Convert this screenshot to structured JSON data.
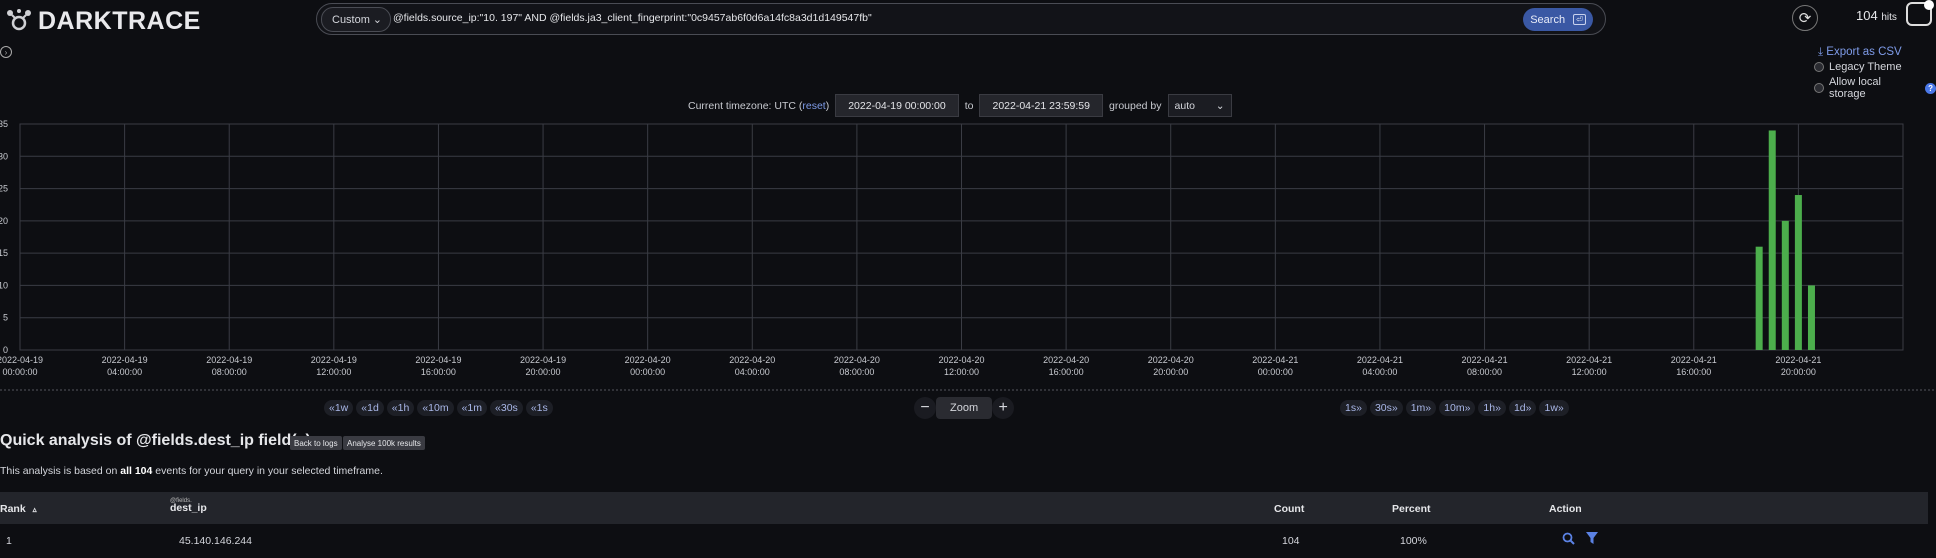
{
  "app": {
    "logo_text": "DARKTRACE"
  },
  "search": {
    "query_type": "Custom",
    "query_text": "@fields.source_ip:\"10.          197\" AND @fields.ja3_client_fingerprint:\"0c9457ab6f0d6a14fc8a3d1d149547fb\"",
    "button_label": "Search"
  },
  "header": {
    "hits_count": "104",
    "hits_label": "hits"
  },
  "options": {
    "export_csv": "Export as CSV",
    "legacy_theme": "Legacy Theme",
    "allow_local_storage": "Allow local storage"
  },
  "timerange": {
    "tz_label": "Current timezone: UTC (",
    "reset_label": "reset",
    "tz_close": ")",
    "from": "2022-04-19 00:00:00",
    "to_label": "to",
    "to": "2022-04-21 23:59:59",
    "grouped_by_label": "grouped by",
    "group_value": "auto"
  },
  "chart_data": {
    "type": "bar",
    "y_tick_labels": [
      "35",
      "30",
      "25",
      "20",
      "15",
      "10",
      "5",
      "0"
    ],
    "ylim": [
      0,
      35
    ],
    "x_tick_dates": [
      "2022-04-19",
      "2022-04-19",
      "2022-04-19",
      "2022-04-19",
      "2022-04-19",
      "2022-04-19",
      "2022-04-20",
      "2022-04-20",
      "2022-04-20",
      "2022-04-20",
      "2022-04-20",
      "2022-04-20",
      "2022-04-21",
      "2022-04-21",
      "2022-04-21",
      "2022-04-21",
      "2022-04-21",
      "2022-04-21"
    ],
    "x_tick_times": [
      "00:00:00",
      "04:00:00",
      "08:00:00",
      "12:00:00",
      "16:00:00",
      "20:00:00",
      "00:00:00",
      "04:00:00",
      "08:00:00",
      "12:00:00",
      "16:00:00",
      "20:00:00",
      "00:00:00",
      "04:00:00",
      "08:00:00",
      "12:00:00",
      "16:00:00",
      "20:00:00"
    ],
    "x_tick_hours": [
      0,
      4,
      8,
      12,
      16,
      20,
      24,
      28,
      32,
      36,
      40,
      44,
      48,
      52,
      56,
      60,
      64,
      68
    ],
    "bars": [
      {
        "hour": 66.5,
        "value": 16
      },
      {
        "hour": 67.0,
        "value": 34
      },
      {
        "hour": 67.5,
        "value": 20
      },
      {
        "hour": 68.0,
        "value": 24
      },
      {
        "hour": 68.5,
        "value": 10
      }
    ],
    "bar_color": "#4cae4c"
  },
  "nav": {
    "back": [
      "«1w",
      "«1d",
      "«1h",
      "«10m",
      "«1m",
      "«30s",
      "«1s"
    ],
    "forward": [
      "1s»",
      "30s»",
      "1m»",
      "10m»",
      "1h»",
      "1d»",
      "1w»"
    ],
    "zoom_minus": "−",
    "zoom_label": "Zoom",
    "zoom_plus": "+"
  },
  "analysis": {
    "title": "Quick analysis of @fields.dest_ip field(s)",
    "back_to_logs": "Back to logs",
    "analyse_100k": "Analyse 100k results",
    "note_prefix": "This analysis is based on ",
    "note_bold": "all 104",
    "note_suffix": " events for your query in your selected timeframe."
  },
  "table": {
    "col_rank": "Rank",
    "col_field_prefix": "@fields.",
    "col_field": "dest_ip",
    "col_count": "Count",
    "col_percent": "Percent",
    "col_action": "Action",
    "rows": [
      {
        "rank": "1",
        "value": "45.140.146.244",
        "count": "104",
        "percent": "100%"
      }
    ]
  }
}
